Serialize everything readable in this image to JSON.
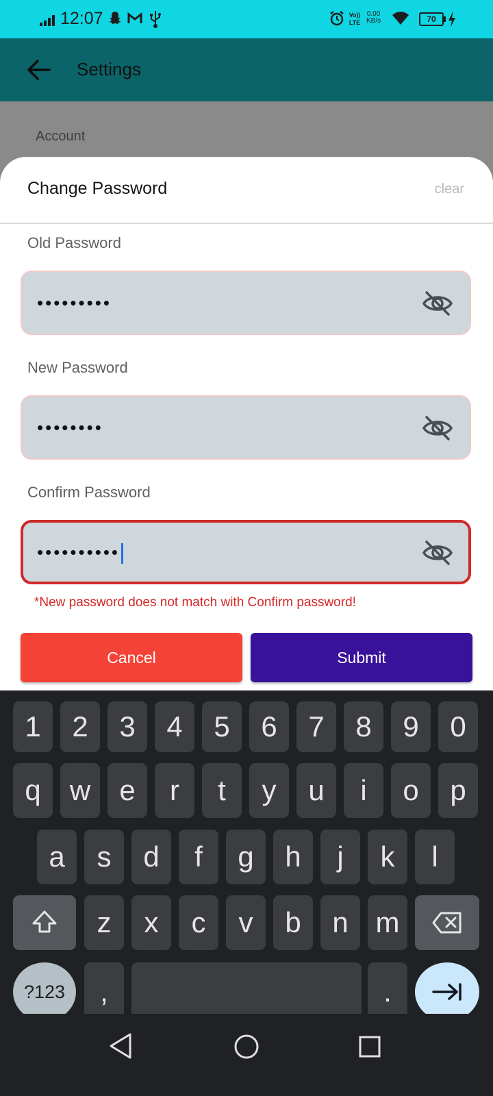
{
  "status_bar": {
    "time": "12:07",
    "netspeed_value": "0.00",
    "netspeed_unit": "KB/s",
    "battery": "70",
    "icons": [
      "signal-icon",
      "snapchat-icon",
      "gmail-icon",
      "usb-icon",
      "alarm-icon",
      "volte-icon",
      "wifi-icon",
      "battery-icon",
      "charging-icon"
    ]
  },
  "app_bar": {
    "title": "Settings",
    "back_icon": "arrow-back-icon"
  },
  "background_page": {
    "section_label": "Account"
  },
  "sheet": {
    "title": "Change Password",
    "clear_label": "clear",
    "fields": [
      {
        "label": "Old Password",
        "value": "•••••••••",
        "toggle_icon": "eye-off-icon"
      },
      {
        "label": "New Password",
        "value": "••••••••",
        "toggle_icon": "eye-off-icon"
      },
      {
        "label": "Confirm Password",
        "value": "••••••••••",
        "toggle_icon": "eye-off-icon",
        "focused": true
      }
    ],
    "error": "*New password does not match with Confirm password!",
    "cancel_label": "Cancel",
    "submit_label": "Submit"
  },
  "keyboard": {
    "row_numbers": [
      "1",
      "2",
      "3",
      "4",
      "5",
      "6",
      "7",
      "8",
      "9",
      "0"
    ],
    "row1": [
      "q",
      "w",
      "e",
      "r",
      "t",
      "y",
      "u",
      "i",
      "o",
      "p"
    ],
    "row2": [
      "a",
      "s",
      "d",
      "f",
      "g",
      "h",
      "j",
      "k",
      "l"
    ],
    "row3": [
      "z",
      "x",
      "c",
      "v",
      "b",
      "n",
      "m"
    ],
    "symbols_label": "?123",
    "comma": ",",
    "period": ".",
    "shift_icon": "shift-icon",
    "backspace_icon": "backspace-icon",
    "next_icon": "tab-next-icon"
  },
  "nav_bar": {
    "icons": [
      "back-triangle-icon",
      "home-circle-icon",
      "recents-square-icon"
    ]
  },
  "colors": {
    "status_bar": "#10d6e3",
    "app_bar": "#0b6467",
    "error": "#d62828",
    "cancel": "#f44336",
    "submit": "#38129a",
    "keyboard_bg": "#1f2124"
  }
}
